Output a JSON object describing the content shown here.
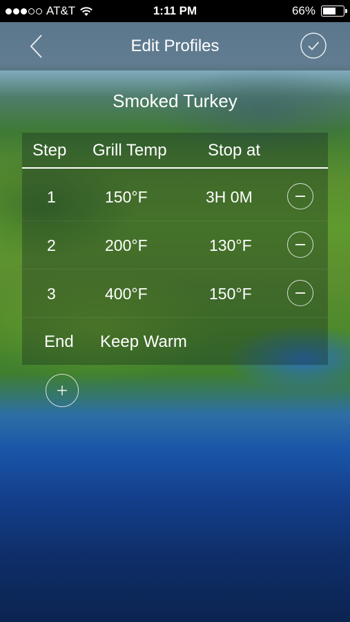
{
  "status_bar": {
    "carrier": "AT&T",
    "time": "1:11 PM",
    "battery_label": "66%",
    "battery_level": 0.66,
    "signal_bars_filled": 3,
    "signal_bars_total": 5
  },
  "nav": {
    "title": "Edit Profiles",
    "back_icon": "chevron-left-icon",
    "done_icon": "checkmark-circle-icon"
  },
  "profile": {
    "name": "Smoked Turkey"
  },
  "table": {
    "headers": {
      "step": "Step",
      "grill_temp": "Grill Temp",
      "stop_at": "Stop at"
    },
    "rows": [
      {
        "step": "1",
        "grill_temp": "150°F",
        "stop_at": "3H 0M"
      },
      {
        "step": "2",
        "grill_temp": "200°F",
        "stop_at": "130°F"
      },
      {
        "step": "3",
        "grill_temp": "400°F",
        "stop_at": "150°F"
      }
    ],
    "end": {
      "label": "End",
      "action": "Keep Warm"
    }
  },
  "icons": {
    "remove": "minus-circle-icon",
    "add": "plus-circle-icon"
  },
  "colors": {
    "status_bar_bg": "#000000",
    "text": "#ffffff"
  }
}
